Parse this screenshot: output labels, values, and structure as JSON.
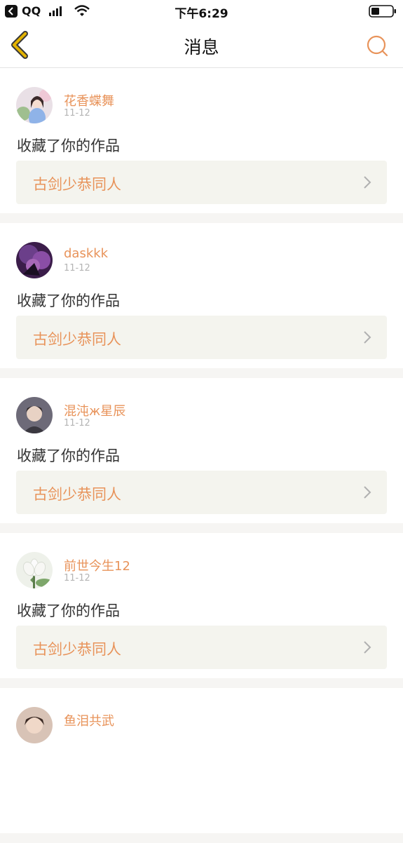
{
  "status_bar": {
    "app": "QQ",
    "time": "下午6:29"
  },
  "nav": {
    "title": "消息"
  },
  "messages": [
    {
      "user": "花香蝶舞",
      "date": "11-12",
      "action": "收藏了你的作品",
      "work": "古剑少恭同人"
    },
    {
      "user": "daskkk",
      "date": "11-12",
      "action": "收藏了你的作品",
      "work": "古剑少恭同人"
    },
    {
      "user": "混沌ж星辰",
      "date": "11-12",
      "action": "收藏了你的作品",
      "work": "古剑少恭同人"
    },
    {
      "user": "前世今生12",
      "date": "11-12",
      "action": "收藏了你的作品",
      "work": "古剑少恭同人"
    },
    {
      "user": "鱼泪共武",
      "date": "",
      "action": "",
      "work": ""
    }
  ],
  "colors": {
    "accent": "#e8935a",
    "back_arrow": "#e3b300"
  }
}
